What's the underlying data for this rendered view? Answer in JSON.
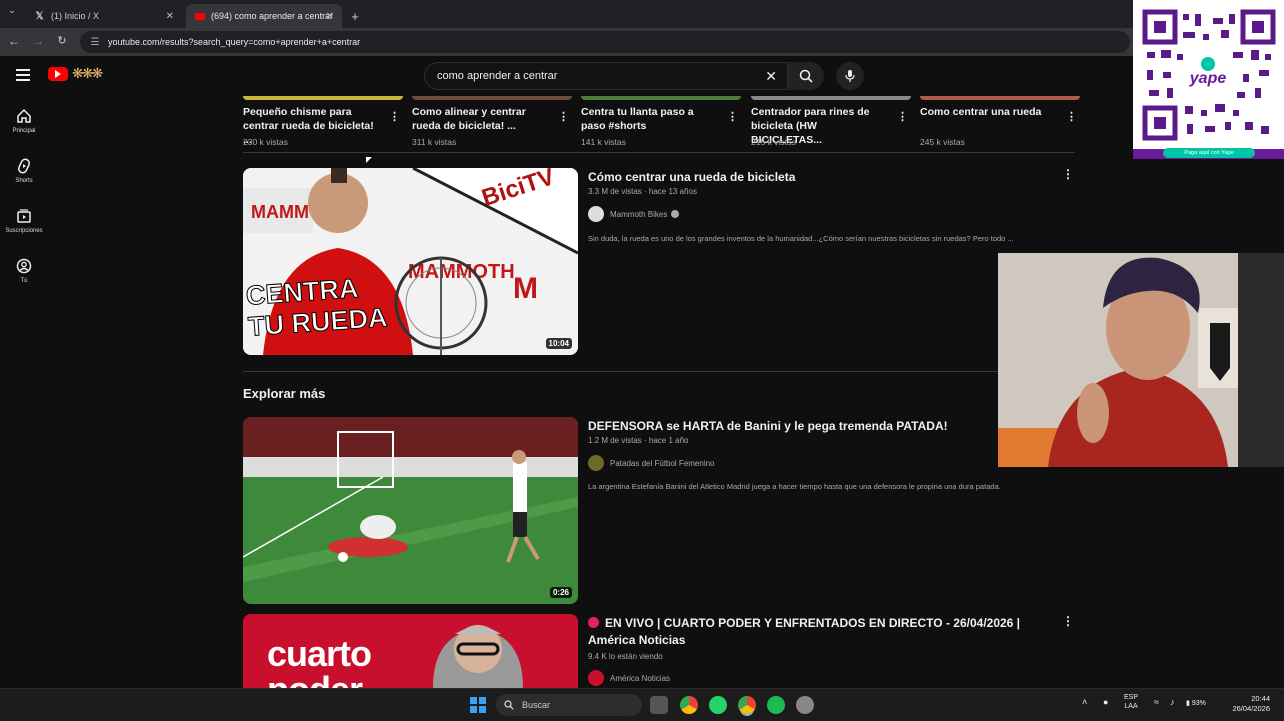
{
  "browser": {
    "tabs": [
      {
        "label": "(1) Inicio / X",
        "icon": "x-logo-icon",
        "active": false
      },
      {
        "label": "(694) como aprender a centrar",
        "icon": "youtube-icon",
        "active": true
      }
    ],
    "new_tab_glyph": "+",
    "url": "youtube.com/results?search_query=como+aprender+a+centrar"
  },
  "youtube": {
    "search_value": "como aprender a centrar",
    "sidebar": [
      {
        "label": "Principal",
        "icon": "home-icon"
      },
      {
        "label": "Shorts",
        "icon": "shorts-icon"
      },
      {
        "label": "Suscripciones",
        "icon": "subscriptions-icon"
      },
      {
        "label": "Tú",
        "icon": "you-icon"
      }
    ],
    "shorts": [
      {
        "title": "Pequeño chisme para centrar rueda de bicicleta! ...",
        "views": "230 k vistas"
      },
      {
        "title": "Como alinear y centrar rueda de bicicleta! ...",
        "views": "311 k vistas"
      },
      {
        "title": "Centra tu llanta paso a paso #shorts",
        "views": "141 k vistas"
      },
      {
        "title": "Centrador para rines de bicicleta (HW BICICLETAS...",
        "views": "215 k vistas"
      },
      {
        "title": "Como centrar una rueda",
        "views": "245 k vistas"
      }
    ],
    "videos": [
      {
        "title": "Cómo centrar una rueda de bicicleta",
        "meta": "3.3 M de vistas · hace 13 años",
        "channel": "Mammoth Bikes",
        "description": "Sin duda, la rueda es uno de los grandes inventos de la humanidad...¿Cómo serían nuestras bicicletas sin ruedas? Pero todo ...",
        "duration": "10:04",
        "thumb_text": "CENTRA TU RUEDA",
        "thumb_brand": "BiciTV"
      },
      {
        "title": "DEFENSORA se HARTA de Banini y le pega tremenda PATADA!",
        "meta": "1.2 M de vistas · hace 1 año",
        "channel": "Patadas del Fútbol Femenino",
        "description": "La argentina Estefanía Banini del Atletico Madrid juega a hacer tiempo hasta que una defensora le propina una dura patada.",
        "duration": "0:26"
      },
      {
        "title": "EN VIVO | CUARTO PODER Y ENFRENTADOS EN DIRECTO - 26/04/2026 | América Noticias",
        "meta": "9.4 K lo están viendo",
        "channel": "América Noticias",
        "thumb_text": "cuarto poder"
      }
    ],
    "section_title": "Explorar más"
  },
  "overlay": {
    "qr_brand": "yape",
    "qr_caption": "Paga aquí con Yape"
  },
  "taskbar": {
    "search_label": "Buscar",
    "lang_top": "ESP",
    "lang_bottom": "LAA",
    "battery": "93%",
    "time": "20:44",
    "date": "26/04/2026"
  },
  "colors": {
    "youtube_red": "#ff0000",
    "background": "#0f0f0f",
    "yape_purple": "#6a1b9a"
  }
}
